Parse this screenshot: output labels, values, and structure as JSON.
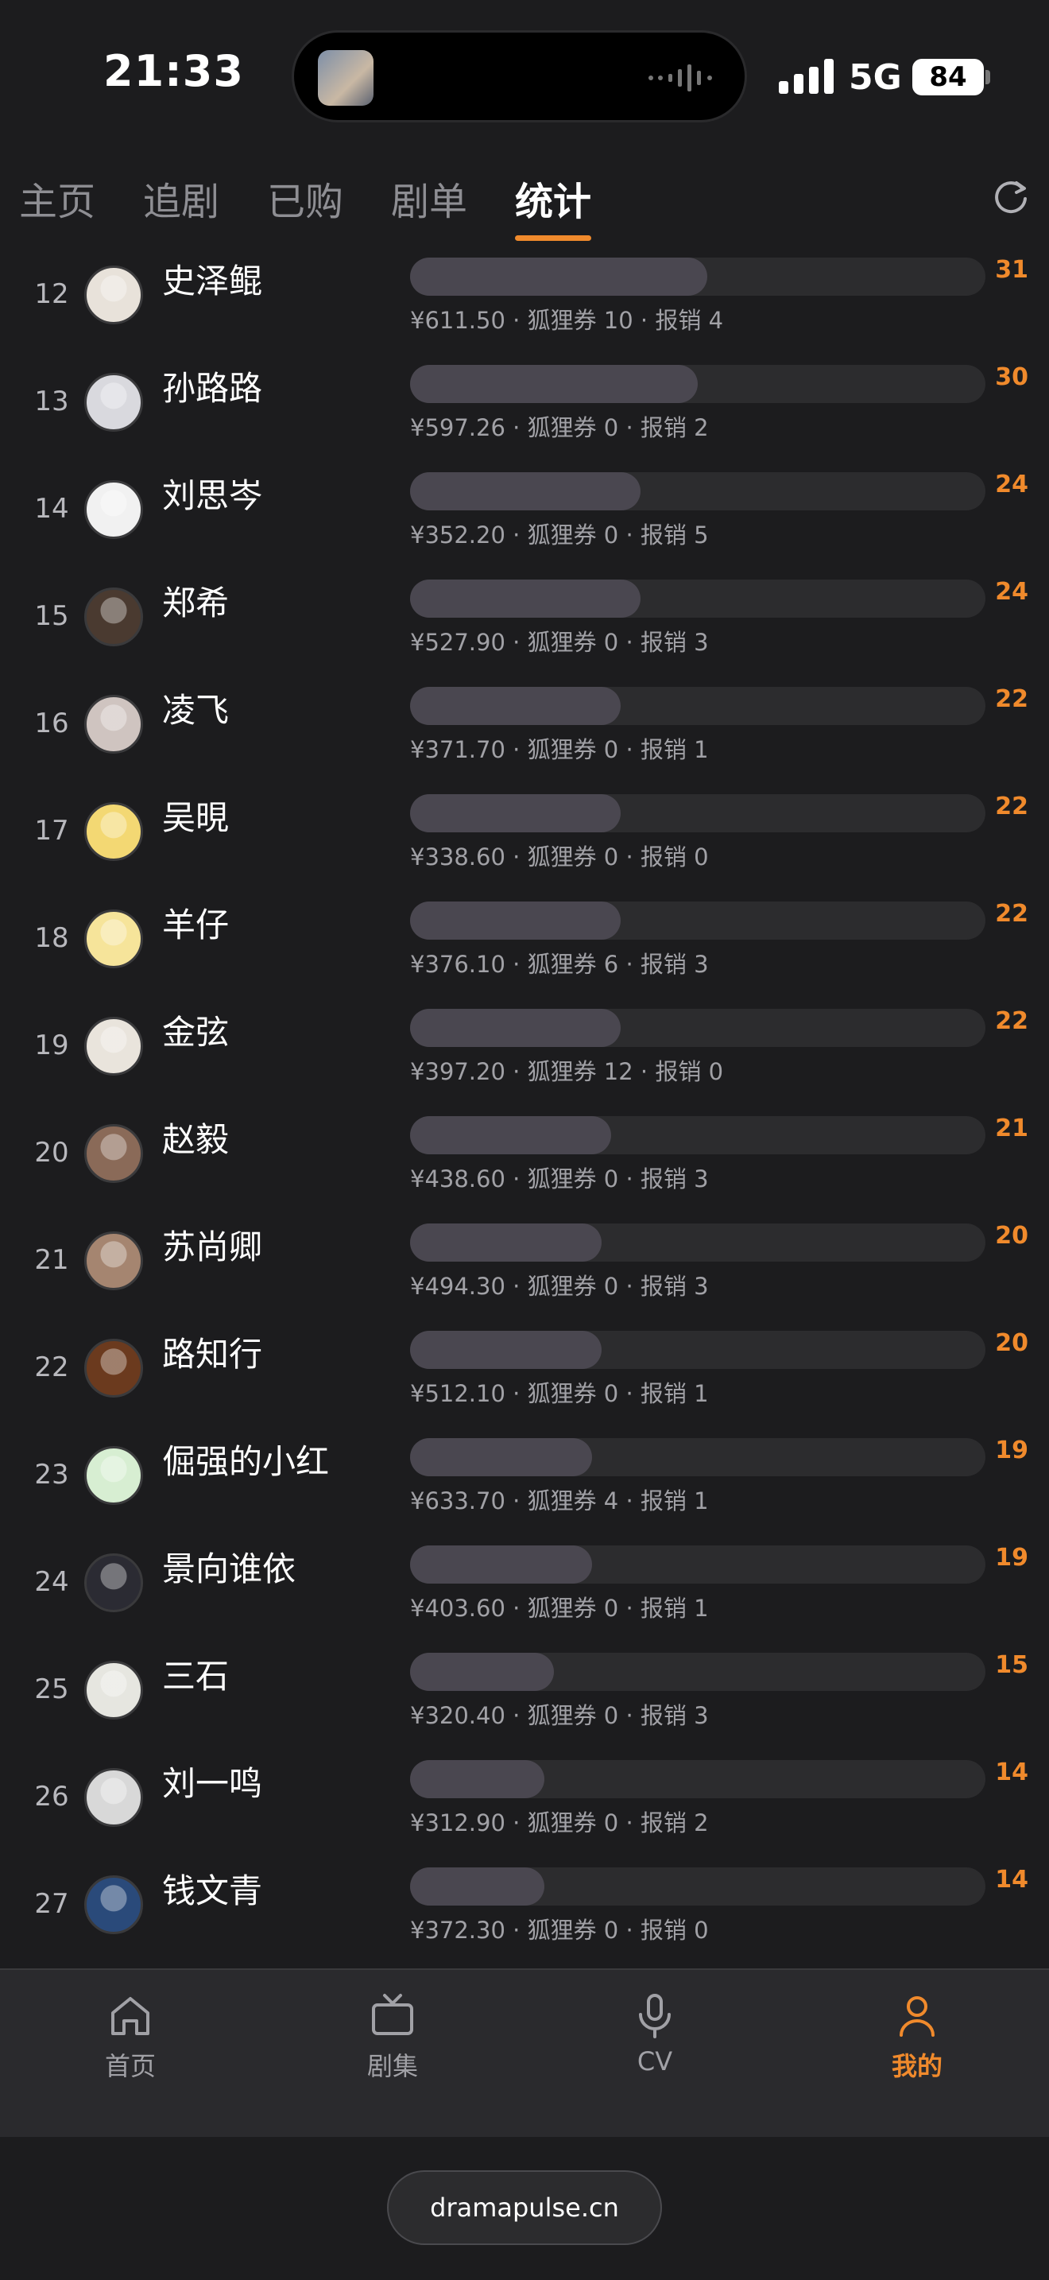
{
  "status_bar": {
    "time": "21:33",
    "network": "5G",
    "battery": "84"
  },
  "tabs": [
    {
      "label": "主页",
      "active": false
    },
    {
      "label": "追剧",
      "active": false
    },
    {
      "label": "已购",
      "active": false
    },
    {
      "label": "剧单",
      "active": false
    },
    {
      "label": "统计",
      "active": true
    }
  ],
  "refresh_icon": "refresh-icon",
  "colors": {
    "accent": "#f08a2c",
    "background": "#1c1c1e",
    "bar_track": "#2c2c2e",
    "bar_fill": "#4a4750"
  },
  "stats": {
    "max_count": 60,
    "rows": [
      {
        "rank": "12",
        "name": "史泽鲲",
        "count": "31",
        "meta": "¥611.50 · 狐狸券 10 · 报销 4",
        "avatar_color": "#e8e2da"
      },
      {
        "rank": "13",
        "name": "孙路路",
        "count": "30",
        "meta": "¥597.26 · 狐狸券 0 · 报销 2",
        "avatar_color": "#d9d9de"
      },
      {
        "rank": "14",
        "name": "刘思岑",
        "count": "24",
        "meta": "¥352.20 · 狐狸券 0 · 报销 5",
        "avatar_color": "#f1f1f1"
      },
      {
        "rank": "15",
        "name": "郑希",
        "count": "24",
        "meta": "¥527.90 · 狐狸券 0 · 报销 3",
        "avatar_color": "#4a3a30"
      },
      {
        "rank": "16",
        "name": "凌飞",
        "count": "22",
        "meta": "¥371.70 · 狐狸券 0 · 报销 1",
        "avatar_color": "#cfc4c0"
      },
      {
        "rank": "17",
        "name": "吴晛",
        "count": "22",
        "meta": "¥338.60 · 狐狸券 0 · 报销 0",
        "avatar_color": "#f3d873"
      },
      {
        "rank": "18",
        "name": "羊仔",
        "count": "22",
        "meta": "¥376.10 · 狐狸券 6 · 报销 3",
        "avatar_color": "#f6e49a"
      },
      {
        "rank": "19",
        "name": "金弦",
        "count": "22",
        "meta": "¥397.20 · 狐狸券 12 · 报销 0",
        "avatar_color": "#e9e4dc"
      },
      {
        "rank": "20",
        "name": "赵毅",
        "count": "21",
        "meta": "¥438.60 · 狐狸券 0 · 报销 3",
        "avatar_color": "#8a6a58"
      },
      {
        "rank": "21",
        "name": "苏尚卿",
        "count": "20",
        "meta": "¥494.30 · 狐狸券 0 · 报销 3",
        "avatar_color": "#a58570"
      },
      {
        "rank": "22",
        "name": "路知行",
        "count": "20",
        "meta": "¥512.10 · 狐狸券 0 · 报销 1",
        "avatar_color": "#6b3a1e"
      },
      {
        "rank": "23",
        "name": "倔强的小红",
        "count": "19",
        "meta": "¥633.70 · 狐狸券 4 · 报销 1",
        "avatar_color": "#d7eed2"
      },
      {
        "rank": "24",
        "name": "景向谁依",
        "count": "19",
        "meta": "¥403.60 · 狐狸券 0 · 报销 1",
        "avatar_color": "#2b2b33"
      },
      {
        "rank": "25",
        "name": "三石",
        "count": "15",
        "meta": "¥320.40 · 狐狸券 0 · 报销 3",
        "avatar_color": "#e6e6e0"
      },
      {
        "rank": "26",
        "name": "刘一鸣",
        "count": "14",
        "meta": "¥312.90 · 狐狸券 0 · 报销 2",
        "avatar_color": "#d8d8d8"
      },
      {
        "rank": "27",
        "name": "钱文青",
        "count": "14",
        "meta": "¥372.30 · 狐狸券 0 · 报销 0",
        "avatar_color": "#2a4a7a"
      }
    ]
  },
  "bottom_nav": [
    {
      "label": "首页",
      "icon": "home-icon",
      "active": false
    },
    {
      "label": "剧集",
      "icon": "tv-icon",
      "active": false
    },
    {
      "label": "CV",
      "icon": "microphone-icon",
      "active": false
    },
    {
      "label": "我的",
      "icon": "user-icon",
      "active": true
    }
  ],
  "browser": {
    "url": "dramapulse.cn"
  }
}
